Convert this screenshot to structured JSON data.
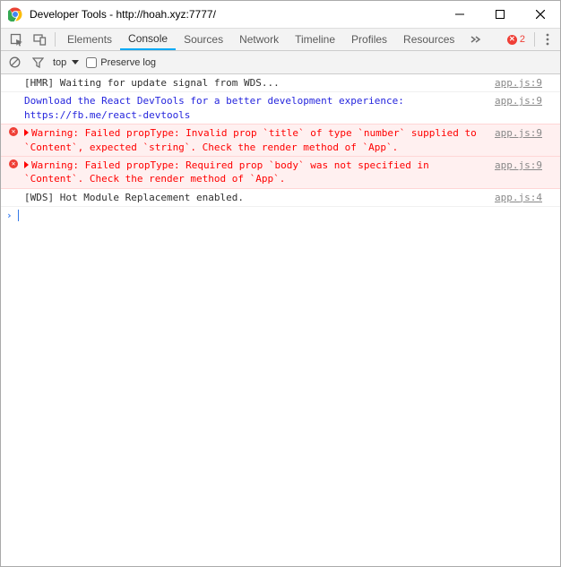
{
  "window": {
    "title": "Developer Tools - http://hoah.xyz:7777/"
  },
  "tabs": {
    "items": [
      "Elements",
      "Console",
      "Sources",
      "Network",
      "Timeline",
      "Profiles",
      "Resources"
    ],
    "active": "Console",
    "error_count": "2"
  },
  "filterbar": {
    "context": "top",
    "preserve_label": "Preserve log"
  },
  "console": {
    "rows": [
      {
        "type": "log",
        "text": "[HMR] Waiting for update signal from WDS...",
        "src": "app.js:9"
      },
      {
        "type": "info",
        "text": "Download the React DevTools for a better development experience: https://fb.me/react-devtools",
        "src": "app.js:9"
      },
      {
        "type": "error",
        "text": "Warning: Failed propType: Invalid prop `title` of type `number` supplied to `Content`, expected `string`. Check the render method of `App`.",
        "src": "app.js:9"
      },
      {
        "type": "error",
        "text": "Warning: Failed propType: Required prop `body` was not specified in `Content`. Check the render method of `App`.",
        "src": "app.js:9"
      },
      {
        "type": "log",
        "text": "[WDS] Hot Module Replacement enabled.",
        "src": "app.js:4"
      }
    ]
  }
}
